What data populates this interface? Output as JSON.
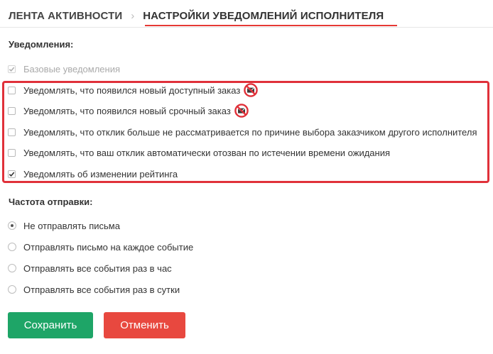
{
  "tabs": [
    {
      "label": "ЛЕНТА АКТИВНОСТИ",
      "active": false
    },
    {
      "label": "НАСТРОЙКИ УВЕДОМЛЕНИЙ ИСПОЛНИТЕЛЯ",
      "active": true
    }
  ],
  "tab_separator": "›",
  "notifications": {
    "title": "Уведомления:",
    "items": [
      {
        "label": "Базовые уведомления",
        "checked": true,
        "disabled": true
      },
      {
        "label": "Уведомлять, что появился новый доступный заказ",
        "checked": false,
        "icon": "mail-blocked-icon"
      },
      {
        "label": "Уведомлять, что появился новый срочный заказ",
        "checked": false,
        "icon": "mail-blocked-icon"
      },
      {
        "label": "Уведомлять, что отклик больше не рассматривается по причине выбора заказчиком другого исполнителя",
        "checked": false
      },
      {
        "label": "Уведомлять, что ваш отклик автоматически отозван по истечении времени ожидания",
        "checked": false
      },
      {
        "label": "Уведомлять об изменении рейтинга",
        "checked": true
      }
    ]
  },
  "frequency": {
    "title": "Частота отправки:",
    "options": [
      {
        "label": "Не отправлять письма",
        "selected": true
      },
      {
        "label": "Отправлять письмо на каждое событие",
        "selected": false
      },
      {
        "label": "Отправлять все события раз в час",
        "selected": false
      },
      {
        "label": "Отправлять все события раз в сутки",
        "selected": false
      }
    ]
  },
  "buttons": {
    "save": "Сохранить",
    "cancel": "Отменить"
  },
  "colors": {
    "accent_red": "#e0313a",
    "save_green": "#1ea567",
    "cancel_red": "#e8483f"
  }
}
